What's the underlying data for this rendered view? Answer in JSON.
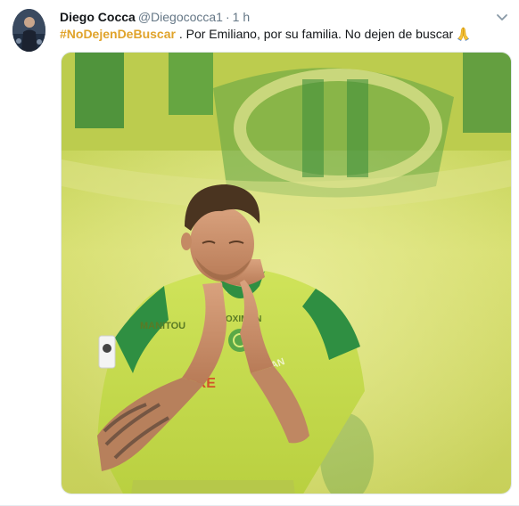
{
  "tweet": {
    "author": {
      "display_name": "Diego Cocca",
      "handle": "@Diegococca1"
    },
    "separator": "·",
    "time": "1 h",
    "hashtag": "#NoDejenDeBuscar",
    "body": " . Por Emiliano, por su familia. No dejen de buscar",
    "emoji_icon": "folded-hands-icon",
    "menu_icon": "chevron-down-icon",
    "colors": {
      "hashtag": "#e0a32a",
      "muted": "#657786",
      "text": "#14171a"
    },
    "media": {
      "jersey_sponsor_left": "MANITOU",
      "jersey_sponsor_right": "PROXIMON",
      "jersey_sleeve": "SAN"
    }
  }
}
